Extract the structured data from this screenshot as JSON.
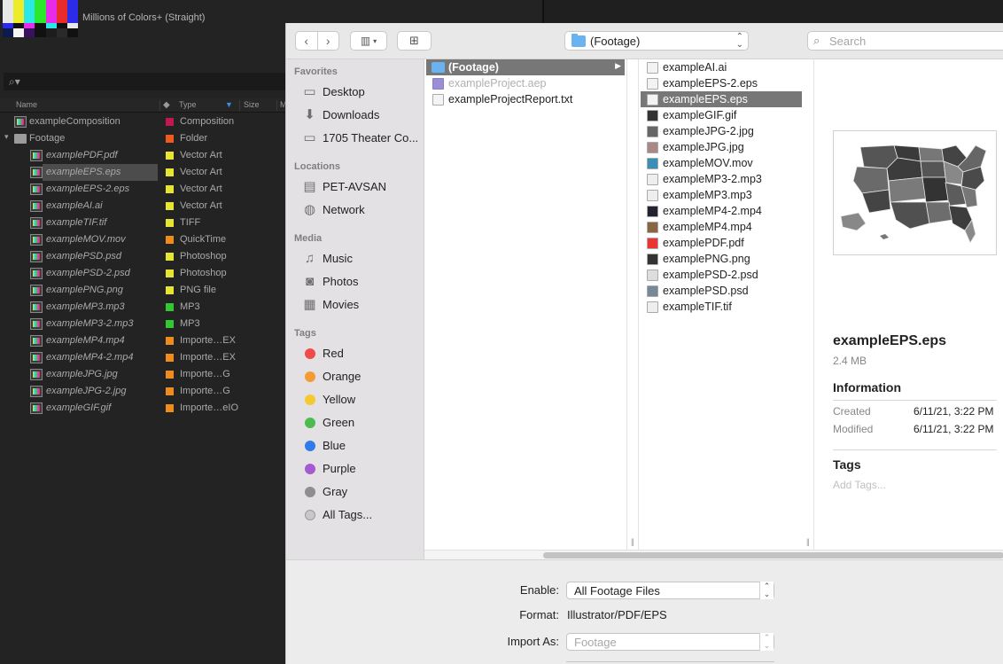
{
  "ae": {
    "thumb_desc": "Millions of Colors+ (Straight)",
    "columns": {
      "name": "Name",
      "type": "Type",
      "size": "Size",
      "m": "M"
    },
    "items": [
      {
        "name": "exampleComposition",
        "type": "Composition",
        "label_color": "#c4164f",
        "kind": "comp",
        "indent": 0
      },
      {
        "name": "Footage",
        "type": "Folder",
        "label_color": "#f05a1e",
        "kind": "folder",
        "indent": 0
      },
      {
        "name": "examplePDF.pdf",
        "type": "Vector Art",
        "label_color": "#e6e632",
        "kind": "file",
        "indent": 1
      },
      {
        "name": "exampleEPS.eps",
        "type": "Vector Art",
        "label_color": "#e6e632",
        "kind": "file",
        "indent": 1,
        "selected": true
      },
      {
        "name": "exampleEPS-2.eps",
        "type": "Vector Art",
        "label_color": "#e6e632",
        "kind": "file",
        "indent": 1
      },
      {
        "name": "exampleAI.ai",
        "type": "Vector Art",
        "label_color": "#e6e632",
        "kind": "file",
        "indent": 1
      },
      {
        "name": "exampleTIF.tif",
        "type": "TIFF",
        "label_color": "#e6e632",
        "kind": "file",
        "indent": 1
      },
      {
        "name": "exampleMOV.mov",
        "type": "QuickTime",
        "label_color": "#f08c1e",
        "kind": "file",
        "indent": 1
      },
      {
        "name": "examplePSD.psd",
        "type": "Photoshop",
        "label_color": "#e6e632",
        "kind": "file",
        "indent": 1
      },
      {
        "name": "examplePSD-2.psd",
        "type": "Photoshop",
        "label_color": "#e6e632",
        "kind": "file",
        "indent": 1
      },
      {
        "name": "examplePNG.png",
        "type": "PNG file",
        "label_color": "#e6e632",
        "kind": "file",
        "indent": 1
      },
      {
        "name": "exampleMP3.mp3",
        "type": "MP3",
        "label_color": "#34c734",
        "kind": "file",
        "indent": 1
      },
      {
        "name": "exampleMP3-2.mp3",
        "type": "MP3",
        "label_color": "#34c734",
        "kind": "file",
        "indent": 1
      },
      {
        "name": "exampleMP4.mp4",
        "type": "Importe…EX",
        "label_color": "#f08c1e",
        "kind": "file",
        "indent": 1
      },
      {
        "name": "exampleMP4-2.mp4",
        "type": "Importe…EX",
        "label_color": "#f08c1e",
        "kind": "file",
        "indent": 1
      },
      {
        "name": "exampleJPG.jpg",
        "type": "Importe…G",
        "label_color": "#f08c1e",
        "kind": "file",
        "indent": 1
      },
      {
        "name": "exampleJPG-2.jpg",
        "type": "Importe…G",
        "label_color": "#f08c1e",
        "kind": "file",
        "indent": 1
      },
      {
        "name": "exampleGIF.gif",
        "type": "Importe…eIO",
        "label_color": "#f08c1e",
        "kind": "file",
        "indent": 1
      }
    ]
  },
  "dialog": {
    "toolbar": {
      "back_icon": "chevron-left-icon",
      "forward_icon": "chevron-right-icon",
      "view_icon": "column-view-icon",
      "new_folder_icon": "new-folder-icon",
      "location": "(Footage)",
      "search_placeholder": "Search"
    },
    "sidebar": {
      "favorites_heading": "Favorites",
      "favorites": [
        {
          "label": "Desktop",
          "icon": "desktop-icon"
        },
        {
          "label": "Downloads",
          "icon": "downloads-icon"
        },
        {
          "label": "1705 Theater Co...",
          "icon": "folder-icon"
        }
      ],
      "locations_heading": "Locations",
      "locations": [
        {
          "label": "PET-AVSAN",
          "icon": "disk-icon"
        },
        {
          "label": "Network",
          "icon": "network-icon"
        }
      ],
      "media_heading": "Media",
      "media": [
        {
          "label": "Music",
          "icon": "music-icon"
        },
        {
          "label": "Photos",
          "icon": "photos-icon"
        },
        {
          "label": "Movies",
          "icon": "movies-icon"
        }
      ],
      "tags_heading": "Tags",
      "tags": [
        {
          "label": "Red",
          "color": "#f04b48"
        },
        {
          "label": "Orange",
          "color": "#f49b33"
        },
        {
          "label": "Yellow",
          "color": "#f3cb31"
        },
        {
          "label": "Green",
          "color": "#4cbc4f"
        },
        {
          "label": "Blue",
          "color": "#2f7be8"
        },
        {
          "label": "Purple",
          "color": "#a55ad1"
        },
        {
          "label": "Gray",
          "color": "#8e8e8e"
        },
        {
          "label": "All Tags...",
          "color": "#c8c8c8"
        }
      ]
    },
    "column1": [
      {
        "label": "(Footage)",
        "kind": "folder",
        "selected": true
      },
      {
        "label": "exampleProject.aep",
        "kind": "aep",
        "dim": true
      },
      {
        "label": "exampleProjectReport.txt",
        "kind": "txt"
      }
    ],
    "column2": [
      {
        "label": "exampleAI.ai"
      },
      {
        "label": "exampleEPS-2.eps"
      },
      {
        "label": "exampleEPS.eps",
        "selected": true
      },
      {
        "label": "exampleGIF.gif"
      },
      {
        "label": "exampleJPG-2.jpg"
      },
      {
        "label": "exampleJPG.jpg"
      },
      {
        "label": "exampleMOV.mov"
      },
      {
        "label": "exampleMP3-2.mp3"
      },
      {
        "label": "exampleMP3.mp3"
      },
      {
        "label": "exampleMP4-2.mp4"
      },
      {
        "label": "exampleMP4.mp4"
      },
      {
        "label": "examplePDF.pdf"
      },
      {
        "label": "examplePNG.png"
      },
      {
        "label": "examplePSD-2.psd"
      },
      {
        "label": "examplePSD.psd"
      },
      {
        "label": "exampleTIF.tif"
      }
    ],
    "preview": {
      "name": "exampleEPS.eps",
      "size": "2.4 MB",
      "info_heading": "Information",
      "created_label": "Created",
      "created_value": "6/11/21, 3:22 PM",
      "modified_label": "Modified",
      "modified_value": "6/11/21, 3:22 PM",
      "tags_heading": "Tags",
      "tags_placeholder": "Add Tags..."
    },
    "bottom": {
      "enable_label": "Enable:",
      "enable_value": "All Footage Files",
      "format_label": "Format:",
      "format_value": "Illustrator/PDF/EPS",
      "import_as_label": "Import As:",
      "import_as_value": "Footage"
    }
  }
}
